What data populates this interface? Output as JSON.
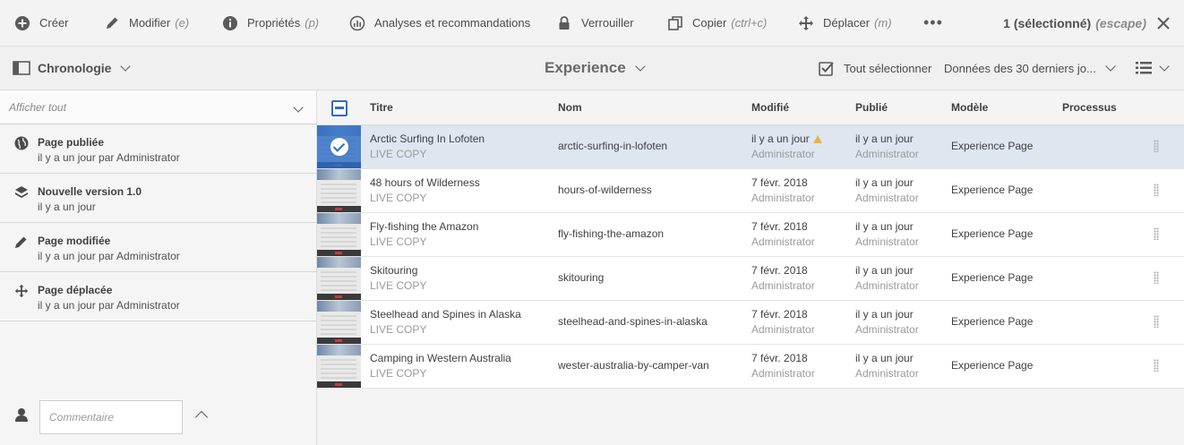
{
  "actionbar": {
    "create": "Créer",
    "modify": "Modifier",
    "modify_kbd": "(e)",
    "properties": "Propriétés",
    "properties_kbd": "(p)",
    "analytics": "Analyses et recommandations",
    "lock": "Verrouiller",
    "copy": "Copier",
    "copy_kbd": "(ctrl+c)",
    "move": "Déplacer",
    "move_kbd": "(m)",
    "more": "•••",
    "selection": "1 (sélectionné)",
    "escape": "(escape)"
  },
  "subbar": {
    "rail_label": "Chronologie",
    "breadcrumb": "Experience",
    "select_all": "Tout sélectionner",
    "date_filter": "Données des 30 derniers jo..."
  },
  "rail": {
    "filter_label": "Afficher tout",
    "items": [
      {
        "title": "Page publiée",
        "subtitle": "il y a un jour par Administrator",
        "icon": "globe-icon"
      },
      {
        "title": "Nouvelle version 1.0",
        "subtitle": "il y a un jour",
        "icon": "layers-icon"
      },
      {
        "title": "Page modifiée",
        "subtitle": "il y a un jour par Administrator",
        "icon": "pencil-icon"
      },
      {
        "title": "Page déplacée",
        "subtitle": "il y a un jour par Administrator",
        "icon": "move-icon"
      }
    ],
    "comment_placeholder": "Commentaire"
  },
  "table": {
    "headers": {
      "title": "Titre",
      "name": "Nom",
      "modified": "Modifié",
      "published": "Publié",
      "model": "Modèle",
      "process": "Processus"
    },
    "rows": [
      {
        "title": "Arctic Surfing In Lofoten",
        "subtitle": "LIVE COPY",
        "name": "arctic-surfing-in-lofoten",
        "modified": "il y a un jour",
        "modified_by": "Administrator",
        "published": "il y a un jour",
        "published_by": "Administrator",
        "model": "Experience Page",
        "selected": true
      },
      {
        "title": "48 hours of Wilderness",
        "subtitle": "LIVE COPY",
        "name": "hours-of-wilderness",
        "modified": "7 févr. 2018",
        "modified_by": "Administrator",
        "published": "il y a un jour",
        "published_by": "Administrator",
        "model": "Experience Page",
        "selected": false
      },
      {
        "title": "Fly-fishing the Amazon",
        "subtitle": "LIVE COPY",
        "name": "fly-fishing-the-amazon",
        "modified": "7 févr. 2018",
        "modified_by": "Administrator",
        "published": "il y a un jour",
        "published_by": "Administrator",
        "model": "Experience Page",
        "selected": false
      },
      {
        "title": "Skitouring",
        "subtitle": "LIVE COPY",
        "name": "skitouring",
        "modified": "7 févr. 2018",
        "modified_by": "Administrator",
        "published": "il y a un jour",
        "published_by": "Administrator",
        "model": "Experience Page",
        "selected": false
      },
      {
        "title": "Steelhead and Spines in Alaska",
        "subtitle": "LIVE COPY",
        "name": "steelhead-and-spines-in-alaska",
        "modified": "7 févr. 2018",
        "modified_by": "Administrator",
        "published": "il y a un jour",
        "published_by": "Administrator",
        "model": "Experience Page",
        "selected": false
      },
      {
        "title": "Camping in Western Australia",
        "subtitle": "LIVE COPY",
        "name": "wester-australia-by-camper-van",
        "modified": "7 févr. 2018",
        "modified_by": "Administrator",
        "published": "il y a un jour",
        "published_by": "Administrator",
        "model": "Experience Page",
        "selected": false
      }
    ]
  },
  "colors": {
    "accent": "#2d6cc5",
    "selected_row": "#dfe6ef",
    "warning": "#e8b33f"
  }
}
